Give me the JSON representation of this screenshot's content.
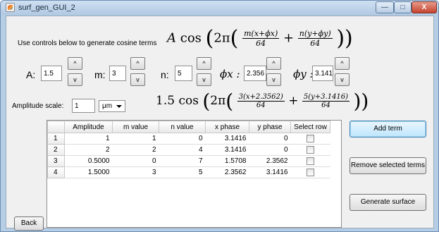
{
  "window": {
    "title": "surf_gen_GUI_2",
    "min_symbol": "—",
    "max_symbol": "□",
    "close_symbol": "X"
  },
  "instructions": {
    "text": "Use controls below to generate cosine terms",
    "formula": {
      "A": "A",
      "cos": "cos",
      "two_pi": "2π",
      "num1": "m(x+ϕx)",
      "num2": "n(y+ϕy)",
      "den": "64",
      "plus": "+"
    }
  },
  "controls": {
    "A_label": "A:",
    "A_value": "1.5",
    "m_label": "m:",
    "m_value": "3",
    "n_label": "n:",
    "n_value": "5",
    "phix_label": "ϕx :",
    "phix_value": "2.356",
    "phiy_label": "ϕy :",
    "phiy_value": "3.141",
    "up_symbol": "^",
    "down_symbol": "v"
  },
  "amplitude": {
    "label": "Amplitude scale:",
    "value": "1",
    "unit": "μm",
    "formula": {
      "coef": "1.5",
      "cos": "cos",
      "two_pi": "2π",
      "num1": "3(x+2.3562)",
      "num2": "5(y+3.1416)",
      "den": "64",
      "plus": "+"
    }
  },
  "table": {
    "columns": [
      "",
      "Amplitude",
      "m value",
      "n value",
      "x phase",
      "y phase",
      "Select row"
    ],
    "rows": [
      {
        "idx": "1",
        "amplitude": "1",
        "m": "1",
        "n": "0",
        "xphase": "3.1416",
        "yphase": "0"
      },
      {
        "idx": "2",
        "amplitude": "2",
        "m": "2",
        "n": "4",
        "xphase": "3.1416",
        "yphase": "0"
      },
      {
        "idx": "3",
        "amplitude": "0.5000",
        "m": "0",
        "n": "7",
        "xphase": "1.5708",
        "yphase": "2.3562"
      },
      {
        "idx": "4",
        "amplitude": "1.5000",
        "m": "3",
        "n": "5",
        "xphase": "2.3562",
        "yphase": "3.1416"
      }
    ]
  },
  "buttons": {
    "add_term": "Add term",
    "remove_selected": "Remove selected terms",
    "generate_surface": "Generate surface",
    "back": "Back"
  }
}
